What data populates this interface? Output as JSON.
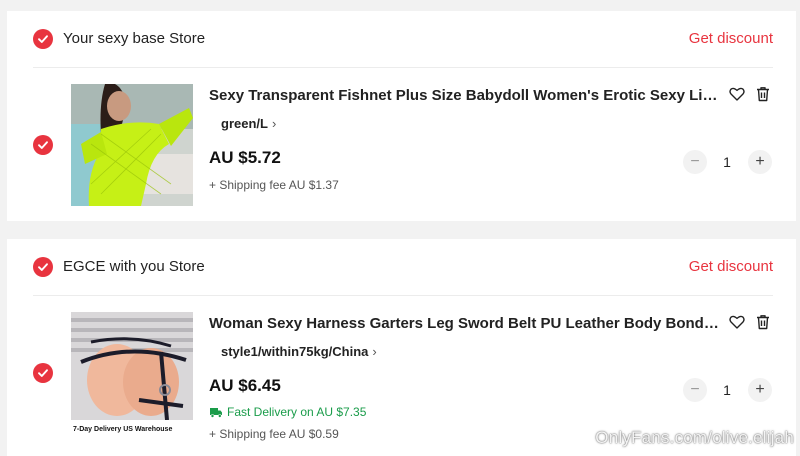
{
  "stores": [
    {
      "name": "Your sexy base Store",
      "discount_label": "Get discount",
      "item": {
        "title": "Sexy Transparent Fishnet Plus Size Babydoll Women's Erotic Sexy Lingerie",
        "sku": "green/L",
        "price": "AU $5.72",
        "shipping": "+ Shipping fee AU $1.37",
        "quantity": "1"
      }
    },
    {
      "name": "EGCE with you Store",
      "discount_label": "Get discount",
      "item": {
        "title": "Woman Sexy Harness Garters Leg Sword Belt PU Leather Body Bondage Lingerie",
        "sku": "style1/within75kg/China",
        "price": "AU $6.45",
        "fast_delivery": "Fast Delivery on AU $7.35",
        "shipping": "+ Shipping fee AU $0.59",
        "quantity": "1",
        "image_badge": "7-Day Delivery  US Warehouse"
      }
    }
  ],
  "stepper": {
    "minus": "−",
    "plus": "+"
  },
  "sku_chevron": "›",
  "watermark": "OnlyFans.com/olive.elijah",
  "colors": {
    "accent": "#e8343f",
    "fast_delivery": "#1a9c4a"
  }
}
